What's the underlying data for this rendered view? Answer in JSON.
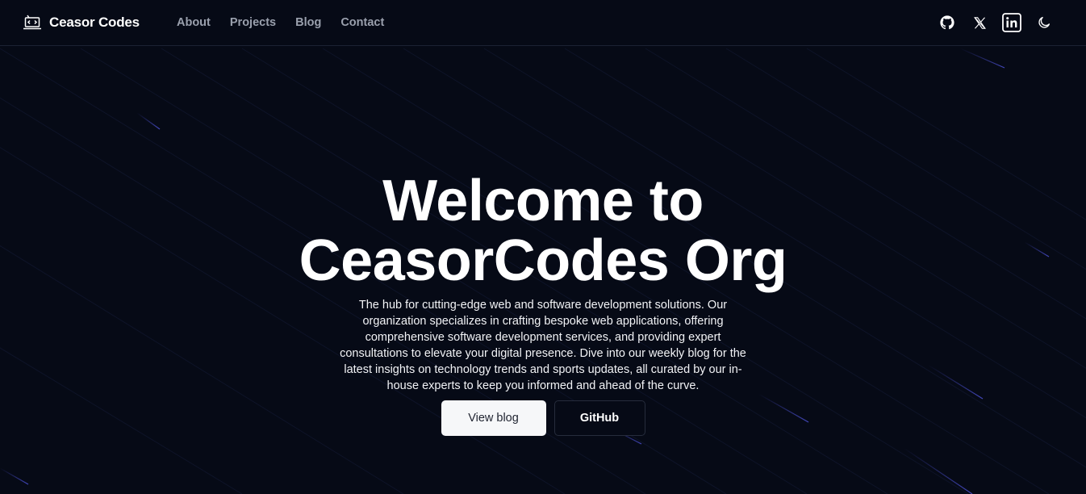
{
  "header": {
    "brand_name": "Ceasor Codes",
    "brand_icon": "laptop-code-icon",
    "nav": [
      {
        "label": "About"
      },
      {
        "label": "Projects"
      },
      {
        "label": "Blog"
      },
      {
        "label": "Contact"
      }
    ],
    "social": [
      "github-icon",
      "x-twitter-icon",
      "linkedin-icon",
      "moon-icon"
    ]
  },
  "hero": {
    "title_line1": "Welcome to",
    "title_line2": "CeasorCodes Org",
    "description": "The hub for cutting-edge web and software development solutions. Our organization specializes in crafting bespoke web applications, offering comprehensive software development services, and providing expert consultations to elevate your digital presence. Dive into our weekly blog for the latest insights on technology trends and sports updates, all curated by our in-house experts to keep you informed and ahead of the curve.",
    "primary_button": "View blog",
    "secondary_button": "GitHub"
  },
  "colors": {
    "background": "#060a16",
    "streak": "#3b3fa6",
    "text": "#ffffff",
    "nav_text": "#9aa0ad"
  }
}
